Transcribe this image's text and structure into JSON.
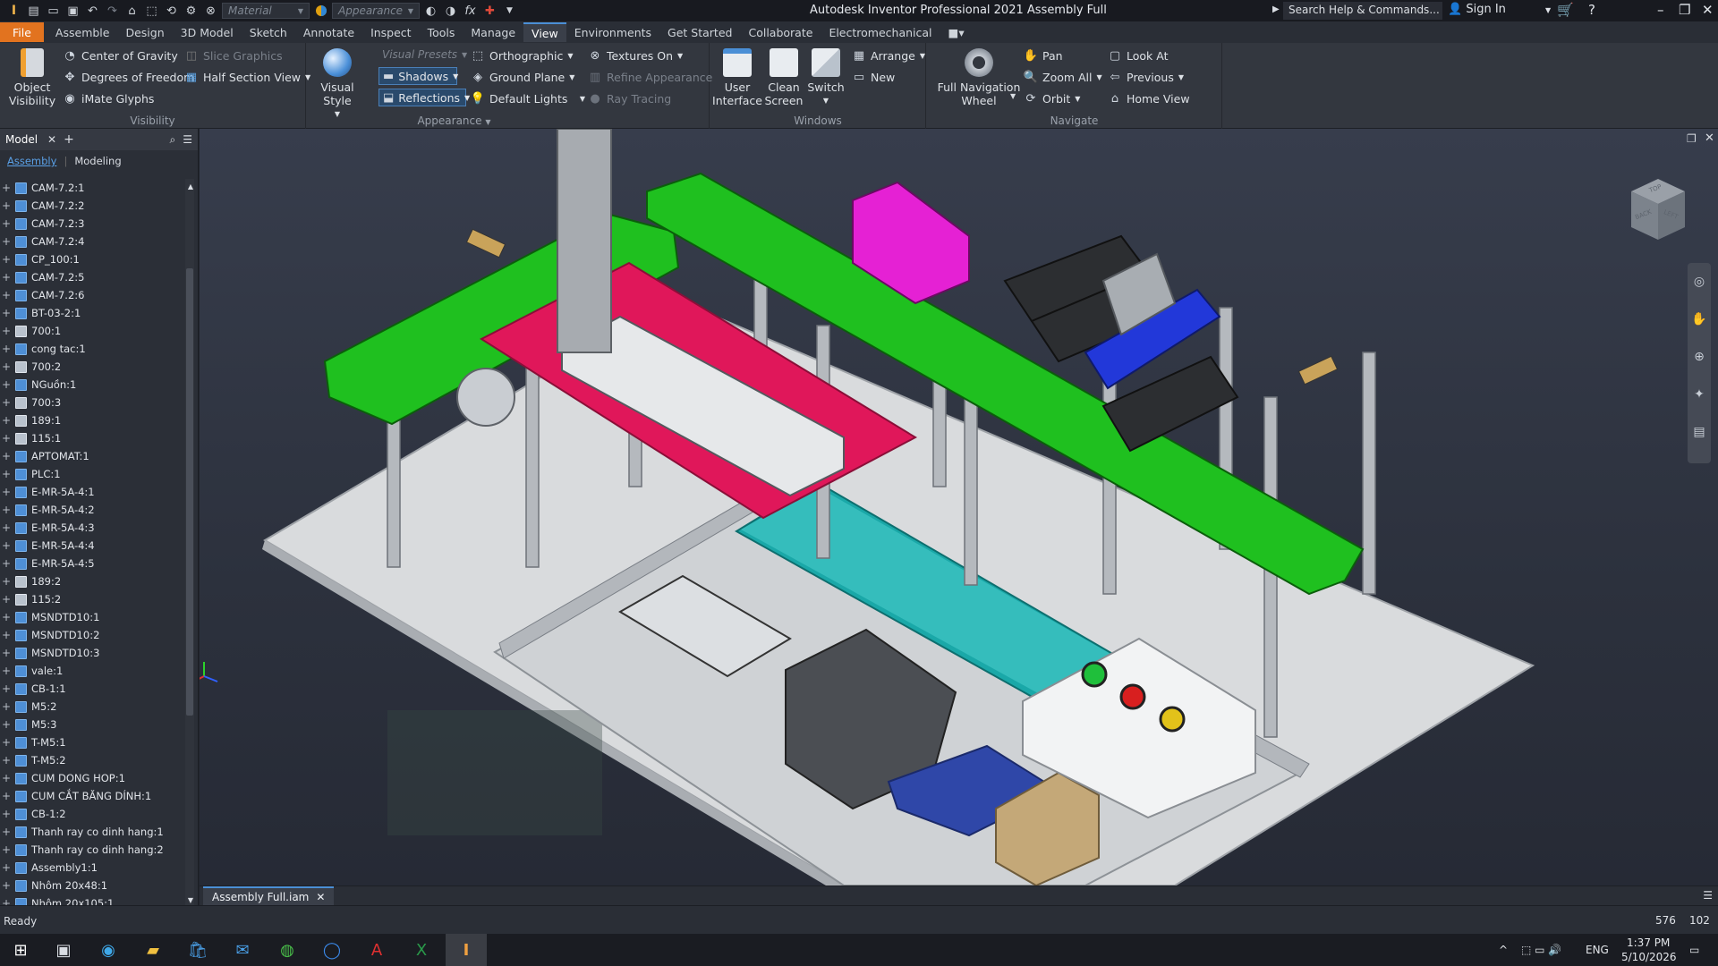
{
  "window": {
    "title": "Autodesk Inventor Professional 2021   Assembly Full",
    "search_placeholder": "Search Help & Commands...",
    "sign_in": "Sign In"
  },
  "quick_access": {
    "material_combo": "Material",
    "appearance_combo": "Appearance"
  },
  "menu_tabs": [
    "File",
    "Assemble",
    "Design",
    "3D Model",
    "Sketch",
    "Annotate",
    "Inspect",
    "Tools",
    "Manage",
    "View",
    "Environments",
    "Get Started",
    "Collaborate",
    "Electromechanical"
  ],
  "active_tab": "View",
  "ribbon": {
    "visibility": {
      "label": "Visibility",
      "object_visibility": "Object\nVisibility",
      "center_of_gravity": "Center of Gravity",
      "degrees_of_freedom": "Degrees of Freedom",
      "imate_glyphs": "iMate Glyphs",
      "slice_graphics": "Slice Graphics",
      "half_section_view": "Half Section View"
    },
    "appearance": {
      "label": "Appearance",
      "visual_style": "Visual Style",
      "visual_presets": "Visual Presets",
      "shadows": "Shadows",
      "reflections": "Reflections",
      "orthographic": "Orthographic",
      "ground_plane": "Ground Plane",
      "default_lights": "Default Lights",
      "textures_on": "Textures On",
      "refine_appearance": "Refine Appearance",
      "ray_tracing": "Ray Tracing"
    },
    "windows": {
      "label": "Windows",
      "user_interface": "User\nInterface",
      "clean_screen": "Clean\nScreen",
      "switch": "Switch",
      "arrange": "Arrange",
      "new": "New"
    },
    "navigate": {
      "label": "Navigate",
      "full_nav_wheel": "Full Navigation\nWheel",
      "pan": "Pan",
      "zoom_all": "Zoom All",
      "orbit": "Orbit",
      "look_at": "Look At",
      "previous": "Previous",
      "home_view": "Home View"
    }
  },
  "browser": {
    "title": "Model",
    "tab_assembly": "Assembly",
    "tab_modeling": "Modeling",
    "items": [
      "CAM-7.2:1",
      "CAM-7.2:2",
      "CAM-7.2:3",
      "CAM-7.2:4",
      "CP_100:1",
      "CAM-7.2:5",
      "CAM-7.2:6",
      "BT-03-2:1",
      "700:1",
      "cong tac:1",
      "700:2",
      "NGuồn:1",
      "700:3",
      "189:1",
      "115:1",
      "APTOMAT:1",
      "PLC:1",
      "E-MR-5A-4:1",
      "E-MR-5A-4:2",
      "E-MR-5A-4:3",
      "E-MR-5A-4:4",
      "E-MR-5A-4:5",
      "189:2",
      "115:2",
      "MSNDTD10:1",
      "MSNDTD10:2",
      "MSNDTD10:3",
      "vale:1",
      "CB-1:1",
      "M5:2",
      "M5:3",
      "T-M5:1",
      "T-M5:2",
      "CUM DONG HOP:1",
      "CUM CẮT BĂNG DÍNH:1",
      "CB-1:2",
      "Thanh ray co dinh hang:1",
      "Thanh ray co dinh hang:2",
      "Assembly1:1",
      "Nhôm 20x48:1",
      "Nhôm 20x105:1"
    ],
    "item_types": [
      "a",
      "a",
      "a",
      "a",
      "a",
      "a",
      "a",
      "a",
      "p",
      "a",
      "p",
      "a",
      "p",
      "p",
      "p",
      "a",
      "a",
      "a",
      "a",
      "a",
      "a",
      "a",
      "p",
      "p",
      "a",
      "a",
      "a",
      "a",
      "a",
      "a",
      "a",
      "a",
      "a",
      "a",
      "a",
      "a",
      "a",
      "a",
      "a",
      "a",
      "a"
    ]
  },
  "document_tab": "Assembly Full.iam",
  "status": {
    "text": "Ready",
    "num1": "576",
    "num2": "102"
  },
  "viewcube": {
    "faces": [
      "TOP",
      "BACK",
      "LEFT"
    ]
  },
  "taskbar": {
    "lang": "ENG",
    "time": "1:37 PM",
    "date": "5/10/2026"
  }
}
